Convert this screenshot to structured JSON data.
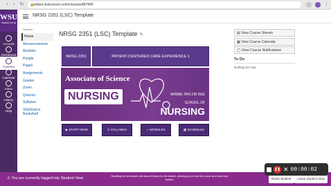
{
  "browser": {
    "url": "webwr.instructure.com/courses/487840",
    "back": "‹",
    "forward": "›",
    "reload": "↻"
  },
  "global_nav": {
    "logo_main": "WSU",
    "logo_sub": "WEBER STATE",
    "items": [
      {
        "label": "Account",
        "icon": "account-icon"
      },
      {
        "label": "Dashboard",
        "icon": "dashboard-icon"
      },
      {
        "label": "Courses",
        "icon": "courses-icon",
        "active": true
      },
      {
        "label": "Calendar",
        "icon": "calendar-icon"
      },
      {
        "label": "Inbox",
        "icon": "inbox-icon"
      },
      {
        "label": "History",
        "icon": "history-icon"
      },
      {
        "label": "Help",
        "icon": "help-icon"
      }
    ]
  },
  "breadcrumb": "NRSG 2351 (LSC) Template",
  "course_nav": {
    "header": "Student",
    "items": [
      "Home",
      "Announcements",
      "Modules",
      "People",
      "Pages",
      "Assignments",
      "Grades",
      "Zoom",
      "Quizzes",
      "Syllabus",
      "VitalSource Bookshelf"
    ]
  },
  "course_title": "NRSG 2351 (LSC) Template",
  "tiles": {
    "course_code": "NRSG 2351",
    "course_name": "PATIENT-CENTERED CARE EXPERIENCE 1"
  },
  "banner": {
    "line1": "Associate of Science",
    "line2": "NURSING",
    "school1": "MINNIE TAYLOR DEE",
    "school2": "SCHOOL OF",
    "school3": "NURSING"
  },
  "buttons": [
    "▶ START HERE",
    "☰ SYLLABUS",
    "✓ MODULES",
    "▦ SCHEDULE"
  ],
  "sidebar": {
    "buttons": [
      "View Course Stream",
      "View Course Calendar",
      "View Course Notifications"
    ],
    "todo_title": "To Do",
    "todo_empty": "Nothing for now"
  },
  "student_view": {
    "message": "You are currently logged into Student View",
    "note": "Resetting the test student will clear all history for this student, allowing you to view the course as a brand new student.",
    "reset_button": "Reset Student",
    "leave_button": "Leave Student View"
  },
  "recorder": {
    "time": "00:00:02"
  }
}
